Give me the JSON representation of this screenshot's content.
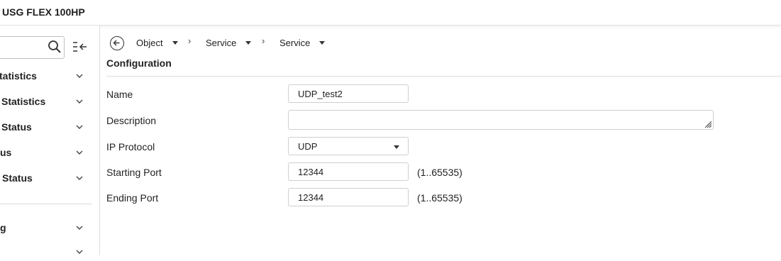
{
  "header": {
    "device_name": "USG FLEX 100HP"
  },
  "sidebar": {
    "search": {
      "placeholder": ""
    },
    "items": [
      {
        "label": "tatistics"
      },
      {
        "label": "Statistics"
      },
      {
        "label": "Status"
      },
      {
        "label": "us"
      },
      {
        "label": "Status"
      },
      {
        "label": "g"
      },
      {
        "label": ""
      }
    ]
  },
  "breadcrumb": [
    {
      "label": "Object"
    },
    {
      "label": "Service"
    },
    {
      "label": "Service"
    }
  ],
  "section": {
    "title": "Configuration"
  },
  "form": {
    "name": {
      "label": "Name",
      "value": "UDP_test2"
    },
    "description": {
      "label": "Description",
      "value": ""
    },
    "ip_protocol": {
      "label": "IP Protocol",
      "value": "UDP"
    },
    "starting_port": {
      "label": "Starting Port",
      "value": "12344",
      "range": "(1..65535)"
    },
    "ending_port": {
      "label": "Ending Port",
      "value": "12344",
      "range": "(1..65535)"
    }
  }
}
